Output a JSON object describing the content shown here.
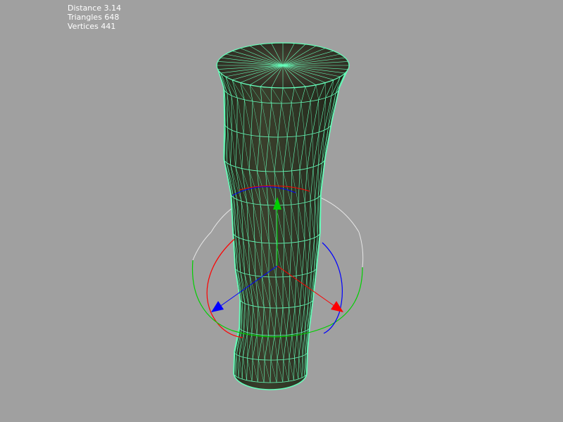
{
  "stats": {
    "distance": "Distance 3.14",
    "triangles": "Triangles 648",
    "vertices": "Vertices 441"
  },
  "colors": {
    "background": "#a0a0a0",
    "wireframe": "#66ffbb",
    "surface": "#2f3525",
    "gizmo_x": "#ff0000",
    "gizmo_y": "#00d000",
    "gizmo_z": "#0000ff",
    "gizmo_outer": "#e6e6e6"
  },
  "icons": [
    "translate-gizmo-icon",
    "rotate-gizmo-icon"
  ]
}
